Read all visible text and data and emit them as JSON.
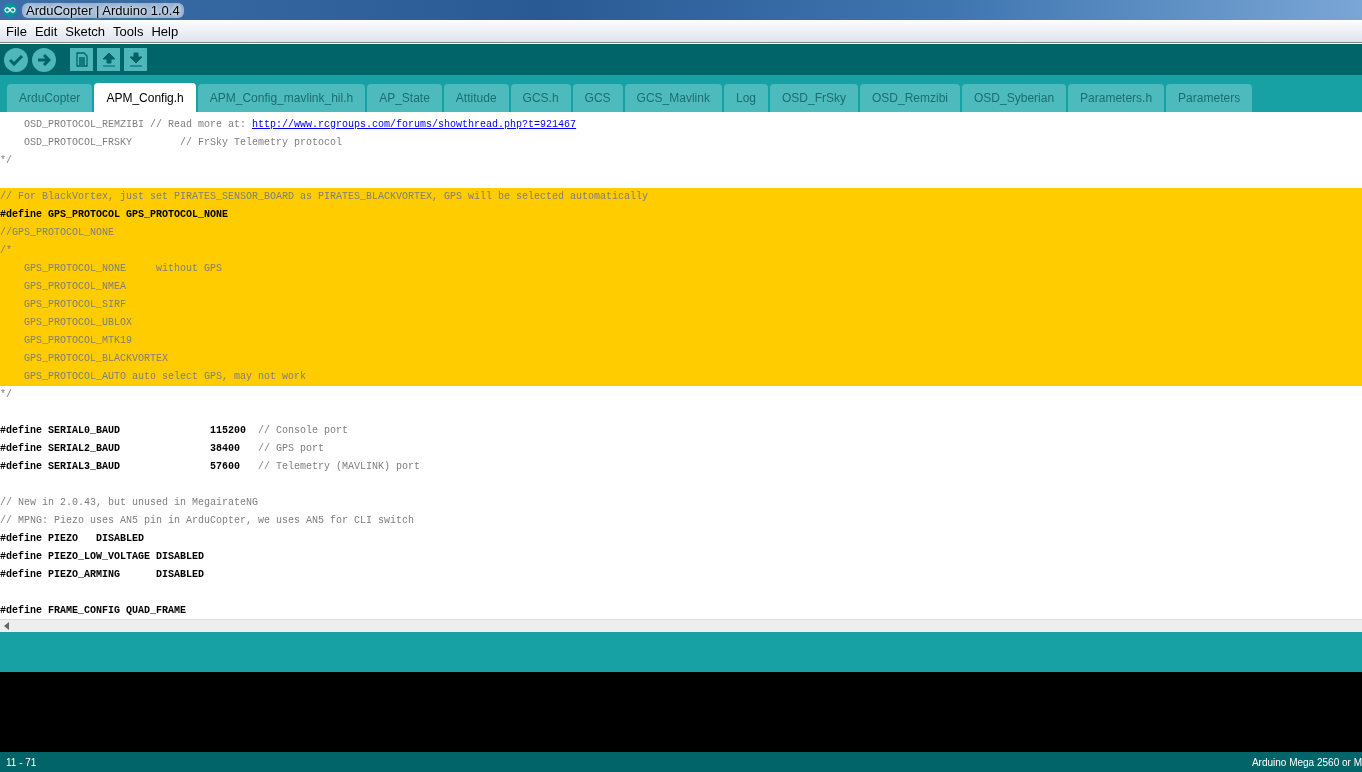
{
  "window": {
    "title": "ArduCopter | Arduino 1.0.4"
  },
  "menu": [
    "File",
    "Edit",
    "Sketch",
    "Tools",
    "Help"
  ],
  "toolbar": [
    {
      "kind": "verify"
    },
    {
      "kind": "upload"
    },
    {
      "kind": "new"
    },
    {
      "kind": "open"
    },
    {
      "kind": "save"
    }
  ],
  "tabs": [
    {
      "label": "ArduCopter",
      "selected": false
    },
    {
      "label": "APM_Config.h",
      "selected": true
    },
    {
      "label": "APM_Config_mavlink_hil.h",
      "selected": false
    },
    {
      "label": "AP_State",
      "selected": false
    },
    {
      "label": "Attitude",
      "selected": false
    },
    {
      "label": "GCS.h",
      "selected": false
    },
    {
      "label": "GCS",
      "selected": false
    },
    {
      "label": "GCS_Mavlink",
      "selected": false
    },
    {
      "label": "Log",
      "selected": false
    },
    {
      "label": "OSD_FrSky",
      "selected": false
    },
    {
      "label": "OSD_Remzibi",
      "selected": false
    },
    {
      "label": "OSD_Syberian",
      "selected": false
    },
    {
      "label": "Parameters.h",
      "selected": false
    },
    {
      "label": "Parameters",
      "selected": false
    }
  ],
  "editor": {
    "blocks": [
      [
        {
          "selected": false,
          "segments": [
            {
              "kind": "comment",
              "text": "    OSD_PROTOCOL_REMZIBI // Read more at: "
            },
            {
              "kind": "link",
              "text": "http://www.rcgroups.com/forums/showthread.php?t=921467"
            }
          ]
        },
        {
          "selected": false,
          "segments": [
            {
              "kind": "comment",
              "text": "    OSD_PROTOCOL_FRSKY        // FrSky Telemetry protocol"
            }
          ]
        },
        {
          "selected": false,
          "segments": [
            {
              "kind": "comment",
              "text": "*/"
            }
          ]
        }
      ],
      [
        {
          "selected": true,
          "segments": [
            {
              "kind": "comment",
              "text": "// For BlackVortex, just set PIRATES_SENSOR_BOARD as PIRATES_BLACKVORTEX, GPS will be selected automatically"
            }
          ]
        },
        {
          "selected": true,
          "segments": [
            {
              "kind": "define",
              "text": "#define GPS_PROTOCOL GPS_PROTOCOL_NONE"
            }
          ]
        },
        {
          "selected": true,
          "segments": [
            {
              "kind": "comment",
              "text": "//GPS_PROTOCOL_NONE"
            }
          ]
        },
        {
          "selected": true,
          "segments": [
            {
              "kind": "comment",
              "text": "/*"
            }
          ]
        },
        {
          "selected": true,
          "segments": [
            {
              "kind": "comment",
              "text": "    GPS_PROTOCOL_NONE     without GPS"
            }
          ]
        },
        {
          "selected": true,
          "segments": [
            {
              "kind": "comment",
              "text": "    GPS_PROTOCOL_NMEA"
            }
          ]
        },
        {
          "selected": true,
          "segments": [
            {
              "kind": "comment",
              "text": "    GPS_PROTOCOL_SIRF"
            }
          ]
        },
        {
          "selected": true,
          "segments": [
            {
              "kind": "comment",
              "text": "    GPS_PROTOCOL_UBLOX"
            }
          ]
        },
        {
          "selected": true,
          "segments": [
            {
              "kind": "comment",
              "text": "    GPS_PROTOCOL_MTK19"
            }
          ]
        },
        {
          "selected": true,
          "segments": [
            {
              "kind": "comment",
              "text": "    GPS_PROTOCOL_BLACKVORTEX"
            }
          ]
        },
        {
          "selected": true,
          "segments": [
            {
              "kind": "comment",
              "text": "    GPS_PROTOCOL_AUTO auto select GPS, may not work"
            }
          ]
        },
        {
          "selected": false,
          "segments": [
            {
              "kind": "comment",
              "text": "*/"
            }
          ]
        }
      ],
      [
        {
          "selected": false,
          "segments": [
            {
              "kind": "define",
              "text": "#define SERIAL0_BAUD               115200"
            },
            {
              "kind": "comment",
              "text": "  // Console port"
            }
          ]
        },
        {
          "selected": false,
          "segments": [
            {
              "kind": "define",
              "text": "#define SERIAL2_BAUD               38400"
            },
            {
              "kind": "comment",
              "text": "   // GPS port"
            }
          ]
        },
        {
          "selected": false,
          "segments": [
            {
              "kind": "define",
              "text": "#define SERIAL3_BAUD               57600"
            },
            {
              "kind": "comment",
              "text": "   // Telemetry (MAVLINK) port"
            }
          ]
        }
      ],
      [
        {
          "selected": false,
          "segments": [
            {
              "kind": "comment",
              "text": "// New in 2.0.43, but unused in MegairateNG"
            }
          ]
        },
        {
          "selected": false,
          "segments": [
            {
              "kind": "comment",
              "text": "// MPNG: Piezo uses AN5 pin in ArduCopter, we uses AN5 for CLI switch"
            }
          ]
        },
        {
          "selected": false,
          "segments": [
            {
              "kind": "define",
              "text": "#define PIEZO   DISABLED"
            }
          ]
        },
        {
          "selected": false,
          "segments": [
            {
              "kind": "define",
              "text": "#define PIEZO_LOW_VOLTAGE DISABLED"
            }
          ]
        },
        {
          "selected": false,
          "segments": [
            {
              "kind": "define",
              "text": "#define PIEZO_ARMING      DISABLED"
            }
          ]
        }
      ],
      [
        {
          "selected": false,
          "segments": [
            {
              "kind": "define",
              "text": "#define FRAME_CONFIG QUAD_FRAME"
            }
          ]
        }
      ]
    ]
  },
  "status_bar": {
    "line": "11 - 71",
    "board": "Arduino Mega 2560 or M"
  }
}
